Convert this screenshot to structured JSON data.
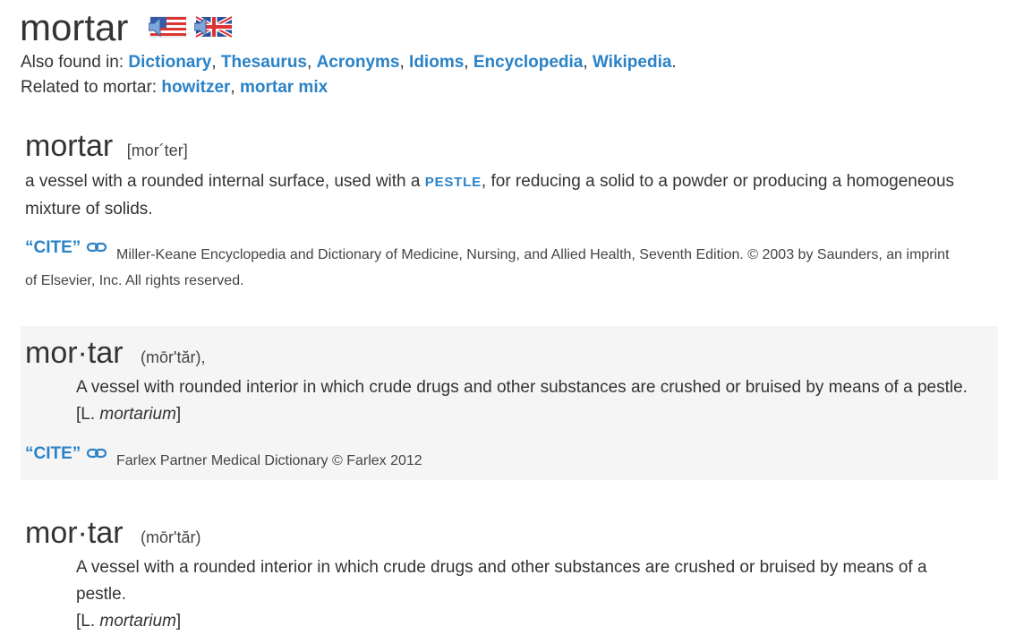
{
  "word": "mortar",
  "audio": {
    "us_icon": "speaker-us-flag-icon",
    "uk_icon": "speaker-uk-flag-icon"
  },
  "also_found": {
    "label": "Also found in: ",
    "links": [
      "Dictionary",
      "Thesaurus",
      "Acronyms",
      "Idioms",
      "Encyclopedia",
      "Wikipedia"
    ],
    "sep": ", ",
    "end": "."
  },
  "related": {
    "label": "Related to mortar: ",
    "links": [
      "howitzer",
      "mortar mix"
    ]
  },
  "entries": [
    {
      "title": "mortar",
      "pron": "[mor´ter]",
      "def_pre": "a vessel with a rounded internal surface, used with a ",
      "def_link": "PESTLE",
      "def_post": ", for reducing a solid to a powder or producing a homogeneous",
      "def_line2": "mixture of solids.",
      "cite_label": "“CITE”",
      "source_line1": "Miller-Keane Encyclopedia and Dictionary of Medicine, Nursing, and Allied Health, Seventh Edition. © 2003 by Saunders, an imprint",
      "source_line2": "of Elsevier, Inc. All rights reserved."
    },
    {
      "title": "mor·tar",
      "pron": "(mōr'tăr),",
      "def": "A vessel with rounded interior in which crude drugs and other substances are crushed or bruised by means of a pestle.",
      "etym_open": "[L. ",
      "etym_word": "mortarium",
      "etym_close": "]",
      "cite_label": "“CITE”",
      "source": "Farlex Partner Medical Dictionary © Farlex 2012"
    },
    {
      "title": "mor·tar",
      "pron": "(mōr'tăr)",
      "def_line1": "A vessel with a rounded interior in which crude drugs and other substances are crushed or bruised by means of a",
      "def_line2": "pestle.",
      "etym_open": "[L. ",
      "etym_word": "mortarium",
      "etym_close": "]"
    }
  ],
  "colors": {
    "link": "#2a82c7",
    "text": "#333333",
    "shade": "#f5f5f5"
  }
}
